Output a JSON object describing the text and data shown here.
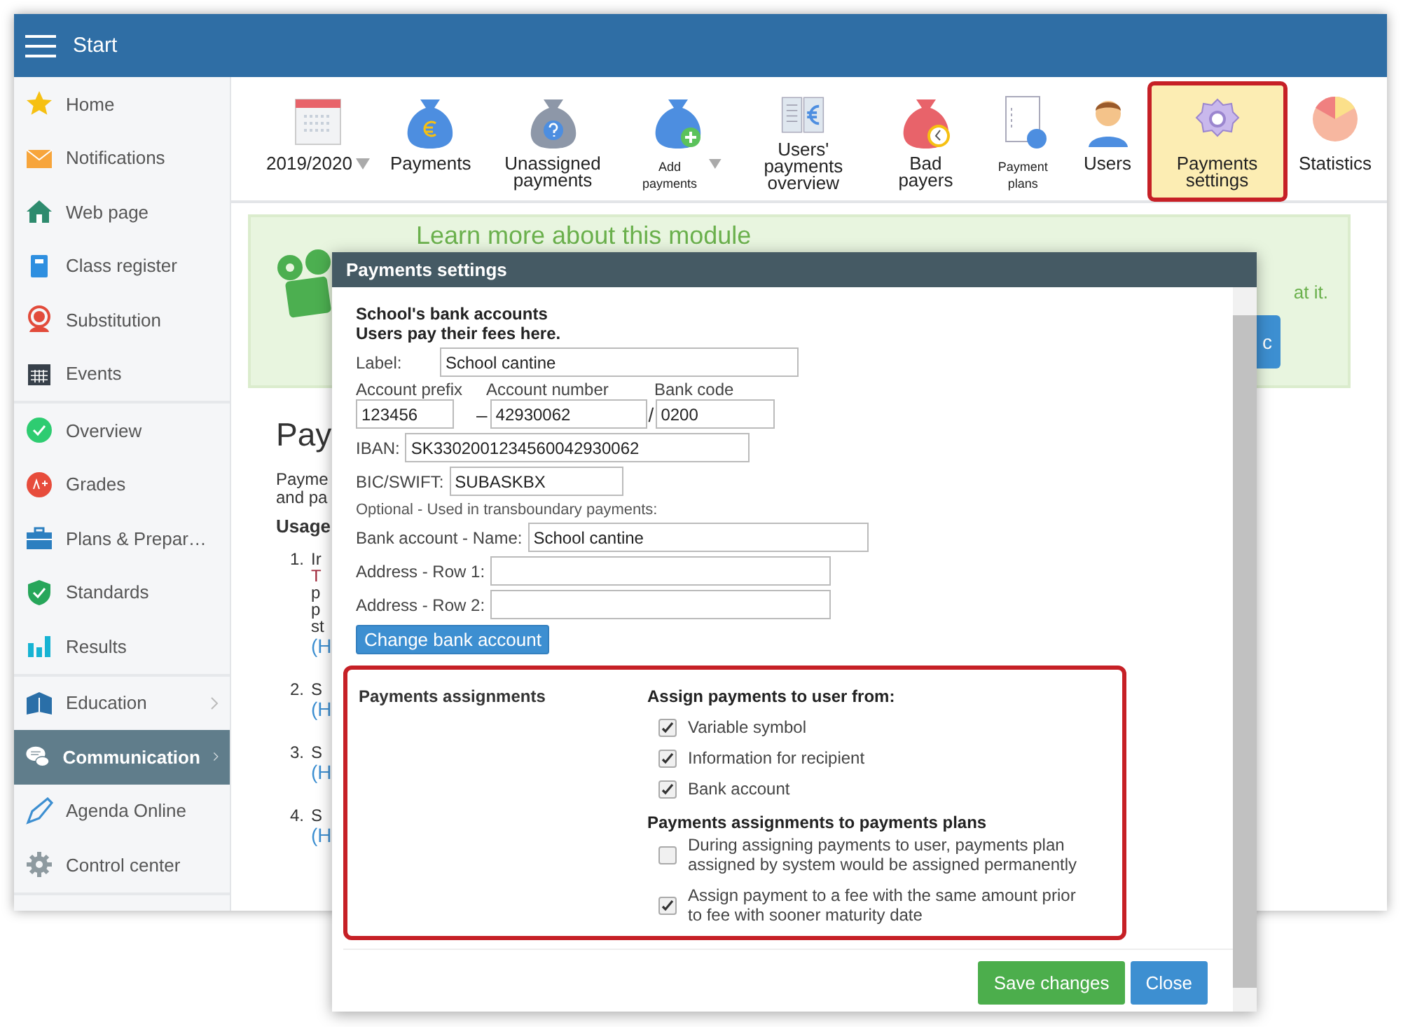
{
  "header": {
    "title": "Start"
  },
  "sidebar": {
    "groups": [
      {
        "items": [
          {
            "label": "Home",
            "selected": false
          },
          {
            "label": "Notifications",
            "selected": false
          },
          {
            "label": "Web page",
            "selected": false
          },
          {
            "label": "Class register",
            "selected": false
          },
          {
            "label": "Substitution",
            "selected": false
          },
          {
            "label": "Events",
            "selected": false
          }
        ]
      },
      {
        "items": [
          {
            "label": "Overview",
            "selected": false
          },
          {
            "label": "Grades",
            "selected": false
          },
          {
            "label": "Plans & Prepar…",
            "selected": false
          },
          {
            "label": "Standards",
            "selected": false
          },
          {
            "label": "Results",
            "selected": false
          }
        ]
      },
      {
        "items": [
          {
            "label": "Education",
            "selected": false,
            "has_submenu": true
          },
          {
            "label": "Communication",
            "selected": true,
            "has_submenu": true
          },
          {
            "label": "Agenda Online",
            "selected": false,
            "has_submenu": false
          },
          {
            "label": "Control center",
            "selected": false,
            "has_submenu": false
          }
        ]
      }
    ]
  },
  "toolbar": [
    {
      "label": "2019/2020",
      "kind": "calendar",
      "has_menu": true,
      "selected": false
    },
    {
      "label": "Payments",
      "kind": "money-bag",
      "has_menu": false,
      "selected": false
    },
    {
      "label": "Unassigned payments",
      "kind": "question-bag",
      "has_menu": false,
      "selected": false
    },
    {
      "label": "Add payments",
      "kind": "add-bag",
      "has_menu": true,
      "selected": false
    },
    {
      "label": "Users' payments overview",
      "kind": "book",
      "has_menu": false,
      "selected": false
    },
    {
      "label": "Bad payers",
      "kind": "overdue-bag",
      "has_menu": false,
      "selected": false
    },
    {
      "label": "Payment plans",
      "kind": "document",
      "has_menu": false,
      "selected": false
    },
    {
      "label": "Users",
      "kind": "user",
      "has_menu": false,
      "selected": false
    },
    {
      "label": "Payments settings",
      "kind": "gear",
      "has_menu": false,
      "selected": true
    },
    {
      "label": "Statistics",
      "kind": "pie",
      "has_menu": false,
      "selected": false
    }
  ],
  "banner": {
    "title": "Learn more about this module",
    "text_tail": "at it.",
    "button": "c"
  },
  "page": {
    "heading": "Pay",
    "intro_lines": [
      "Payme",
      "and pa"
    ],
    "usage": "Usage",
    "steps": [
      {
        "number": "1.",
        "lines": [
          "Ir",
          "T",
          "p",
          "p",
          "st",
          "(H"
        ]
      },
      {
        "number": "2.",
        "lines": [
          "S",
          "(H"
        ]
      },
      {
        "number": "3.",
        "lines": [
          "S",
          "(H"
        ]
      },
      {
        "number": "4.",
        "lines": [
          "S",
          "(H"
        ]
      }
    ]
  },
  "dialog": {
    "title": "Payments settings",
    "bank": {
      "heading": "School's bank accounts",
      "subheading": "Users pay their fees here.",
      "label_field": {
        "label": "Label:",
        "value": "School cantine"
      },
      "account_labels": [
        "Account prefix",
        "Account number",
        "Bank code"
      ],
      "prefix": "123456",
      "dash": "–",
      "number": "42930062",
      "slash": "/",
      "bank_code": "0200",
      "iban": {
        "label": "IBAN:",
        "value": "SK3302001234560042930062"
      },
      "bic": {
        "label": "BIC/SWIFT:",
        "value": "SUBASKBX"
      },
      "optional_note": "Optional - Used in transboundary payments:",
      "name": {
        "label": "Bank account - Name:",
        "value": "School cantine"
      },
      "address_1": {
        "label": "Address - Row 1:"
      },
      "address_2": {
        "label": "Address - Row 2:"
      },
      "button": "Change bank account"
    },
    "assignments": {
      "title": "Payments assignments",
      "highlighted": true,
      "user_heading": "Assign payments to user from:",
      "user_options": [
        {
          "label": "Variable symbol",
          "checked": true
        },
        {
          "label": "Information for recipient",
          "checked": true
        },
        {
          "label": "Bank account",
          "checked": true
        }
      ],
      "plans_heading": "Payments assignments to payments plans",
      "plan_options": [
        {
          "label": "During assigning payments to user, payments plan assigned by system would be assigned permanently",
          "checked": false
        },
        {
          "label": "Assign payment to a fee with the same amount prior to fee with sooner maturity date",
          "checked": true
        }
      ]
    },
    "buttons": [
      {
        "label": "Save changes",
        "kind": "primary"
      },
      {
        "label": "Close",
        "kind": "secondary"
      }
    ]
  }
}
